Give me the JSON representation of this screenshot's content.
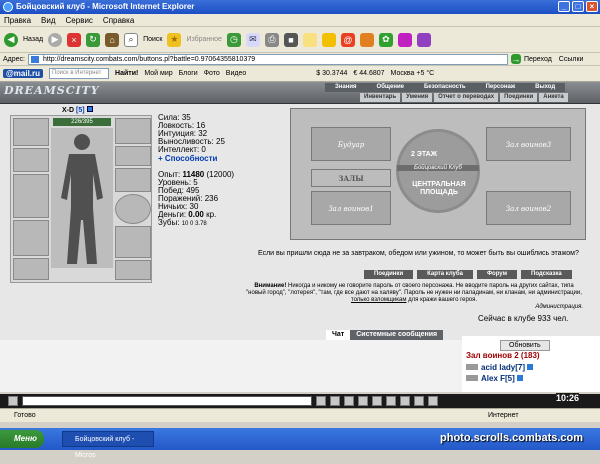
{
  "window": {
    "title": "Бойцовский клуб - Microsoft Internet Explorer",
    "min": "_",
    "max": "□",
    "close": "×"
  },
  "menu": [
    "Правка",
    "Вид",
    "Сервис",
    "Справка"
  ],
  "toolbar": {
    "back": "Назад",
    "search": "Поиск",
    "favorites": "Избранное"
  },
  "address": {
    "label": "Адрес:",
    "url": "http://dreamscity.combats.com/buttons.pl?battle=0.97064355810379",
    "go": "Переход",
    "links": "Ссылки"
  },
  "links_bar": {
    "mailru": "@mail.ru",
    "search_placeholder": "Поиск в Интернет",
    "find": "Найти!",
    "mymir": "Мой мир",
    "blogs": "Блоги",
    "photo": "Фото",
    "video": "Видео",
    "usd": "$ 30.3744",
    "eur": "€ 44.6807",
    "weather": "Москва +5 °С"
  },
  "game": {
    "logo": "DREAMSCITY",
    "topnav": [
      "Знания",
      "Общение",
      "Безопасность",
      "Персонаж",
      "Выход"
    ],
    "subnav": [
      "Инвентарь",
      "Умения",
      "Отчет о переводах",
      "Поединки",
      "Анкета"
    ],
    "char_name": "X-D",
    "char_level": "[5]",
    "hp": "226/395",
    "stats": [
      {
        "label": "Сила:",
        "value": "35"
      },
      {
        "label": "Ловкость:",
        "value": "16"
      },
      {
        "label": "Интуиция:",
        "value": "32"
      },
      {
        "label": "Выносливость:",
        "value": "25"
      },
      {
        "label": "Интеллект:",
        "value": "0"
      }
    ],
    "abilities": "+ Способности",
    "exp_label": "Опыт:",
    "exp_value": "11480",
    "exp_next": "(12000)",
    "stats2": [
      {
        "label": "Уровень:",
        "value": "5"
      },
      {
        "label": "Побед:",
        "value": "495"
      },
      {
        "label": "Поражений:",
        "value": "236"
      },
      {
        "label": "Ничьих:",
        "value": "30"
      }
    ],
    "money_label": "Деньги:",
    "money_value": "0.00",
    "money_unit": "кр.",
    "teeth_label": "Зубы:",
    "teeth_value": "10 0 3.78",
    "map": {
      "boudoir": "Будуар",
      "hall3": "Зал воинов3",
      "floor2": "2 ЭТАЖ",
      "club": "Бойцовский Клуб",
      "halls": "ЗАЛЫ",
      "hall1": "Зал воинов1",
      "square": "ЦЕНТРАЛЬНАЯ ПЛОЩАДЬ",
      "hall2": "Зал воинов2"
    },
    "map_hint": "Если вы пришли сюда не за завтраком, обедом или ужином, то может быть вы ошиблись этажом?",
    "buttons": [
      "Поединки",
      "Карта клуба",
      "Форум",
      "Подсказка"
    ],
    "notice_bold": "Внимание!",
    "notice": "Никогда и никому не говорите пароль от своего персонажа. Не вводите пароль на других сайтах, типа \"новый город\", \"лотерея\", \"там, где все дают на халяву\". Пароль не нужен ни паладинам, ни кланам, ни администрации,",
    "notice_link": "только взломщикам",
    "notice_end": "для кражи вашего героя.",
    "notice_sign": "Администрация.",
    "online": "Сейчас в клубе 933 чел."
  },
  "chat": {
    "tab_chat": "Чат",
    "tab_system": "Системные сообщения",
    "refresh": "Обновить",
    "room": "Зал воинов 2 (183)",
    "players": [
      "acid lady[7]",
      "Alex F[5]"
    ]
  },
  "clock": "10:26",
  "status": {
    "text": "Готово",
    "zone": "Интернет"
  },
  "taskbar": {
    "start": "Меню",
    "item": "Бойцовский клуб - Micros"
  },
  "watermark": "photo.scrolls.combats.com"
}
